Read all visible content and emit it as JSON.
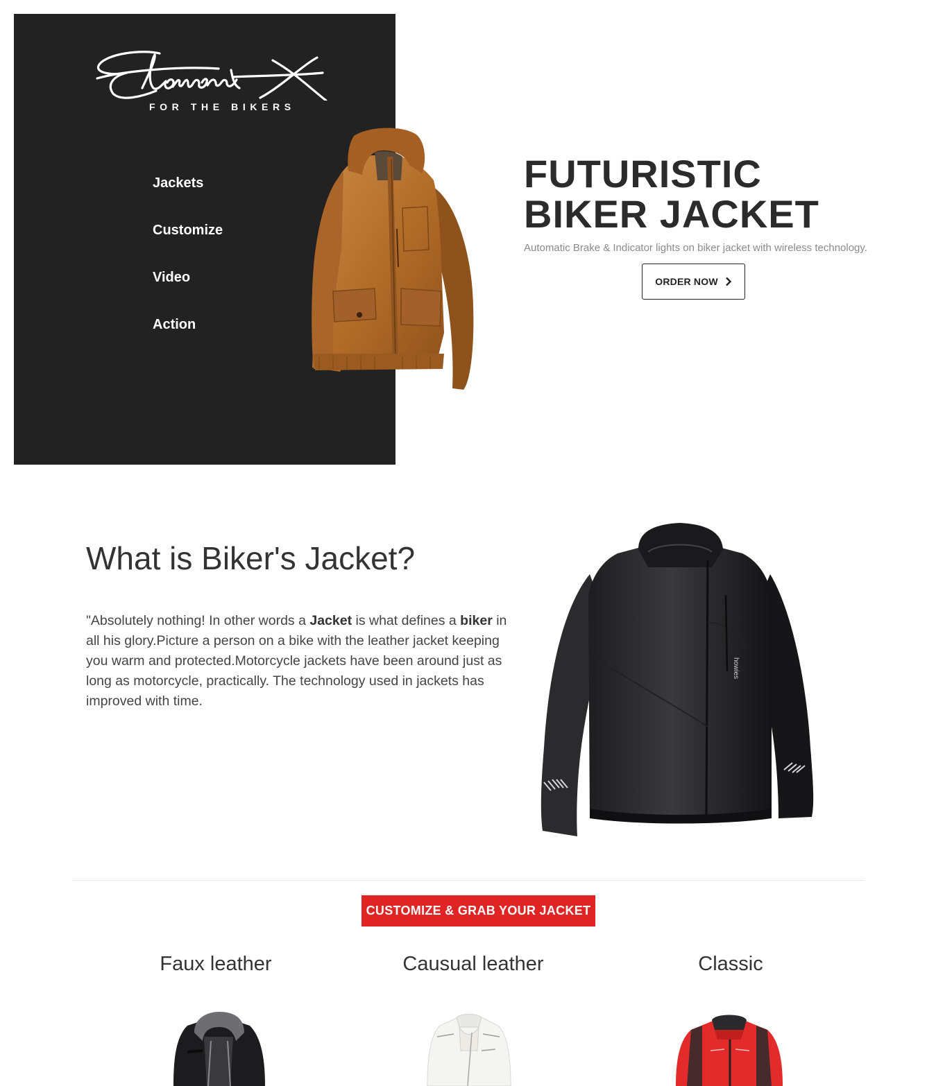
{
  "brand": {
    "name": "Element X",
    "tagline": "FOR THE BIKERS"
  },
  "nav": {
    "items": [
      {
        "label": "Jackets"
      },
      {
        "label": "Customize"
      },
      {
        "label": "Video"
      },
      {
        "label": "Action"
      }
    ]
  },
  "hero": {
    "title_line1": "FUTURISTIC",
    "title_line2": "BIKER JACKET",
    "subtitle": "Automatic Brake & Indicator lights on biker jacket with wireless technology.",
    "cta_label": "ORDER NOW",
    "cta_icon": "chevron-right-icon"
  },
  "about": {
    "title": "What is Biker's Jacket?",
    "text_parts": [
      "\"Absolutely nothing! In other words a ",
      "Jacket",
      " is what defines a ",
      "biker",
      " in all his glory.Picture a person on a bike with the leather jacket keeping you warm and protected.Motorcycle jackets have been around just as long as motorcycle, practically. The technology used in jackets has improved with time."
    ],
    "image_brand": "howies"
  },
  "customize": {
    "cta_label": "CUSTOMIZE & GRAB YOUR JACKET"
  },
  "categories": [
    {
      "title": "Faux leather"
    },
    {
      "title": "Causual leather"
    },
    {
      "title": "Classic"
    }
  ],
  "colors": {
    "panel": "#222222",
    "accent_red": "#e02424",
    "hero_jacket": "#b8702e",
    "dark_jacket": "#2a2a2c"
  }
}
